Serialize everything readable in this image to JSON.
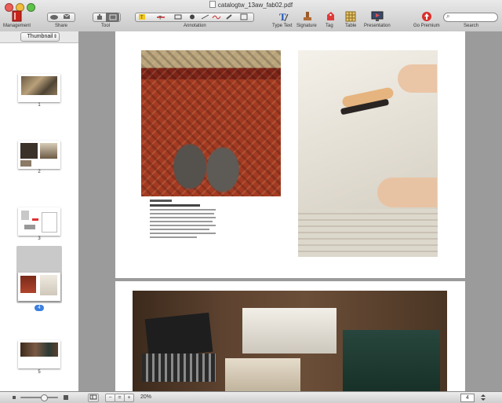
{
  "window": {
    "title": "catalogtw_13aw_fab02.pdf"
  },
  "toolbar": {
    "groups": [
      {
        "label": "Management"
      },
      {
        "label": "Share"
      },
      {
        "label": "Tool"
      },
      {
        "label": "Annotation"
      },
      {
        "label": "Type Text"
      },
      {
        "label": "Signature"
      },
      {
        "label": "Tag"
      },
      {
        "label": "Table"
      },
      {
        "label": "Presentation"
      },
      {
        "label": "Go Premium"
      },
      {
        "label": "Search"
      }
    ]
  },
  "sidebar": {
    "view_mode": "Thumbnail",
    "thumbnails": [
      {
        "page": "1"
      },
      {
        "page": "2"
      },
      {
        "page": "3"
      },
      {
        "page": "4"
      },
      {
        "page": "5"
      }
    ]
  },
  "status": {
    "zoom": "20%",
    "page_number": "4"
  },
  "colors": {
    "accent": "#3b7fe0",
    "premium": "#d9302b",
    "management": "#c8241c"
  }
}
